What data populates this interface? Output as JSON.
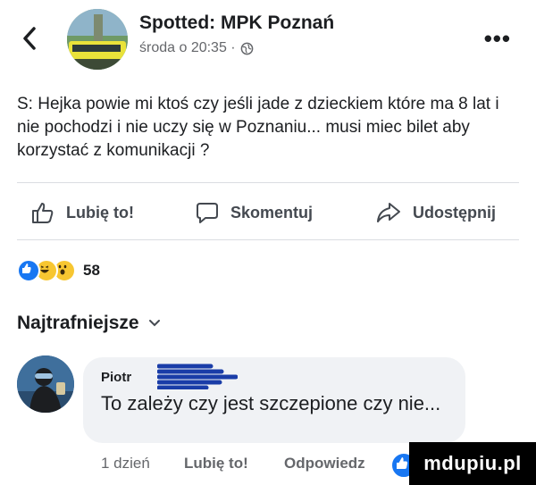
{
  "header": {
    "page_name": "Spotted: MPK Poznań",
    "timestamp": "środa o 20:35 ·",
    "privacy_icon": "globe-icon",
    "more_icon": "ellipsis-icon"
  },
  "post": {
    "text": "S: Hejka powie mi ktoś czy jeśli jade z dzieckiem które ma 8 lat i nie pochodzi i nie uczy się w Poznaniu... musi miec bilet aby korzystać z komunikacji ?"
  },
  "actions": {
    "like_label": "Lubię to!",
    "comment_label": "Skomentuj",
    "share_label": "Udostępnij"
  },
  "reactions": {
    "types": [
      "like",
      "haha",
      "wow"
    ],
    "count": "58"
  },
  "comments_sort": {
    "label": "Najtrafniejsze"
  },
  "comment": {
    "author": "Piotr",
    "text": "To zależy czy jest szczepione czy nie...",
    "time": "1 dzień",
    "like_label": "Lubię to!",
    "reply_label": "Odpowiedz"
  },
  "watermark": {
    "text": "mdupiu.pl"
  },
  "colors": {
    "facebook_blue": "#1877f2",
    "text_primary": "#1c1e21",
    "text_secondary": "#65676b",
    "bubble_bg": "#f0f2f5"
  }
}
